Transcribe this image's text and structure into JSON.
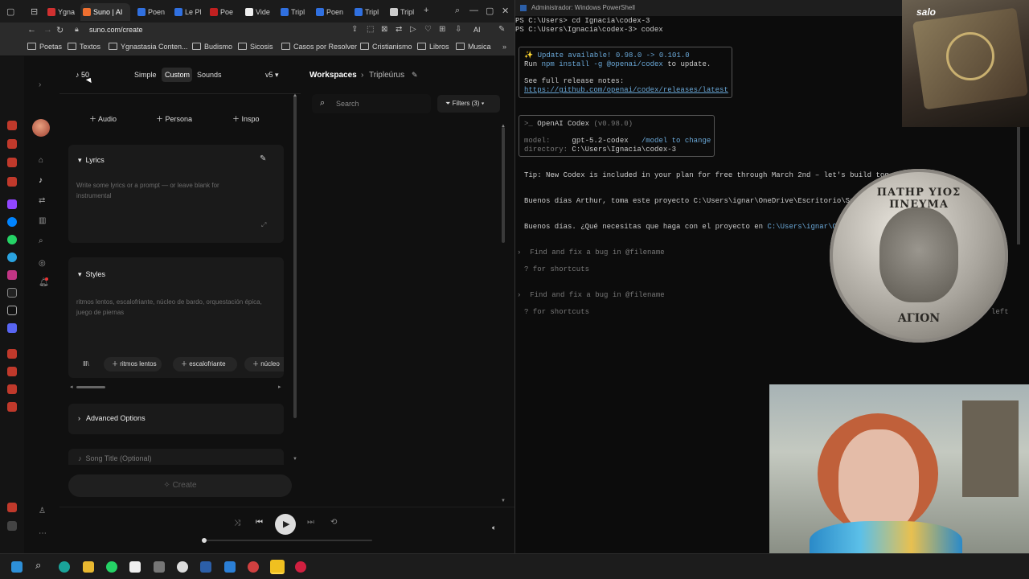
{
  "browser": {
    "tabs": [
      {
        "label": "Ygna",
        "color": "#d03030"
      },
      {
        "label": "Suno | AI",
        "color": "#f07030",
        "active": true
      },
      {
        "label": "Poen",
        "color": "#3070e0"
      },
      {
        "label": "Le Pl",
        "color": "#3070e0"
      },
      {
        "label": "Poe",
        "color": "#c02020"
      },
      {
        "label": "Vide",
        "color": "#eeeeee"
      },
      {
        "label": "Tripl",
        "color": "#3070e0"
      },
      {
        "label": "Poen",
        "color": "#3070e0"
      },
      {
        "label": "Tripl",
        "color": "#3070e0"
      },
      {
        "label": "Tripl",
        "color": "#cccccc"
      }
    ],
    "url": "suno.com/create",
    "ai_label": "AI",
    "bookmarks": [
      "Poetas",
      "Textos",
      "Ygnastasia Conten...",
      "Budismo",
      "Sicosis",
      "Casos por Resolver",
      "Cristianismo",
      "Libros",
      "Musica"
    ]
  },
  "suno": {
    "credits": "50",
    "modes": [
      "Simple",
      "Custom",
      "Sounds"
    ],
    "version": "v5",
    "add_buttons": [
      "Audio",
      "Persona",
      "Inspo"
    ],
    "lyrics": {
      "title": "Lyrics",
      "placeholder": "Write some lyrics or a prompt — or leave blank for instrumental"
    },
    "styles": {
      "title": "Styles",
      "placeholder": "ritmos lentos, escalofriante, núcleo de bardo, orquestación épica, juego de piernas",
      "tags": [
        "ritmos lentos",
        "escalofriante",
        "núcleo"
      ]
    },
    "advanced": "Advanced Options",
    "song_title_placeholder": "Song Title (Optional)",
    "create": "Create",
    "workspace": {
      "crumb": "Workspaces",
      "name": "Tripleúrus",
      "search_placeholder": "Search",
      "filters": "Filters (3)"
    }
  },
  "terminal": {
    "title": "Administrador: Windows PowerShell",
    "lines": [
      "PS C:\\Users> cd Ignacia\\codex-3",
      "PS C:\\Users\\Ignacia\\codex-3> codex"
    ],
    "update": {
      "line1": "Update available! 0.98.0 -> 0.101.0",
      "line2_pre": "Run ",
      "line2_cmd": "npm install -g @openai/codex",
      "line2_post": " to update.",
      "line3": "See full release notes:",
      "link": "https://github.com/openai/codex/releases/latest"
    },
    "codex": {
      "name": "OpenAI Codex",
      "version": "(v0.98.0)",
      "model_label": "model:",
      "model": "gpt-5.2-codex",
      "model_hint": "/model to change",
      "dir_label": "directory:",
      "dir": "C:\\Users\\Ignacia\\codex-3"
    },
    "tip": "Tip: New Codex is included in your plan for free through March 2nd – let's build tog",
    "msg1": "Buenos días Arthur, toma este proyecto C:\\Users\\ignar\\OneDrive\\Escritorio\\Se",
    "msg2_pre": "Buenos días. ¿Qué necesitas que haga con el proyecto en ",
    "msg2_path": "C:\\Users\\ignar\\O",
    "prompt1": "Find and fix a bug in @filename",
    "shortcut1": "? for shortcuts",
    "prompt2": "Find and fix a bug in @filename",
    "shortcut2": "? for shortcuts",
    "left": "left"
  },
  "overlays": {
    "badge": "salo",
    "coin_top": "ΠΑΤΗΡ ΥΙΟΣ ΠΝΕΥΜΑ",
    "coin_bottom": "ΑΓΙΟΝ"
  }
}
